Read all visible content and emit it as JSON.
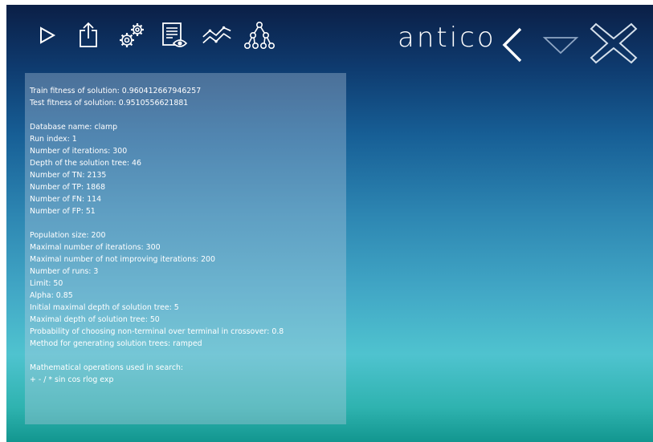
{
  "brand": {
    "logo_text": "antico"
  },
  "toolbar": {
    "tools": [
      {
        "name": "run",
        "icon": "play-icon"
      },
      {
        "name": "export",
        "icon": "share-export-icon"
      },
      {
        "name": "settings",
        "icon": "gears-icon"
      },
      {
        "name": "view-report",
        "icon": "document-eye-icon"
      },
      {
        "name": "fitness-chart",
        "icon": "line-chart-icon"
      },
      {
        "name": "solution-tree",
        "icon": "tree-icon"
      }
    ]
  },
  "window_controls": {
    "back_icon": "chevron-left-icon",
    "minimize_icon": "triangle-down-icon",
    "close_icon": "close-x-icon"
  },
  "colors": {
    "accent": "#ffffff",
    "background_top": "#0b1f46",
    "background_bottom": "#12968f",
    "panel": "rgba(190,205,225,0.35)"
  },
  "results": {
    "fitness": [
      "Train fitness of solution: 0.960412667946257",
      "Test fitness of solution: 0.9510556621881"
    ],
    "run_info": [
      "Database name: clamp",
      "Run index: 1",
      "Number of iterations: 300",
      "Depth of the solution tree: 46",
      "Number of TN: 2135",
      "Number of TP: 1868",
      "Number of FN: 114",
      "Number of FP: 51"
    ],
    "parameters": [
      "Population size: 200",
      "Maximal number of iterations: 300",
      "Maximal number of not improving iterations: 200",
      "Number of runs: 3",
      "Limit: 50",
      "Alpha: 0.85",
      "Initial maximal depth of solution tree: 5",
      "Maximal depth of solution tree: 50",
      "Probability of choosing non-terminal over terminal in crossover: 0.8",
      "Method for generating solution trees: ramped"
    ],
    "operations_label": "Mathematical operations used in search:",
    "operations": "+ - / * sin cos rlog exp"
  }
}
